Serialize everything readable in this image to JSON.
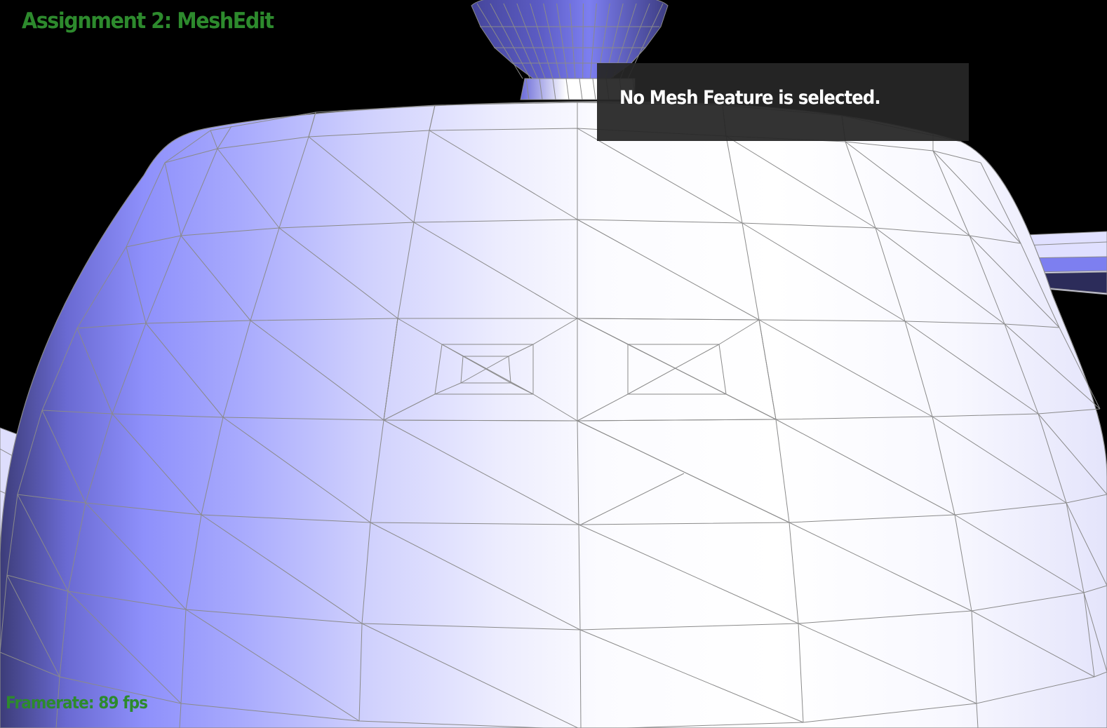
{
  "app": {
    "title": "Assignment 2: MeshEdit"
  },
  "info_panel": {
    "message": "No Mesh Feature is selected."
  },
  "status": {
    "framerate": "Framerate: 89 fps"
  },
  "scene": {
    "object": "teapot-mesh",
    "background_color": "#000000",
    "mesh_base_color": "#8a8cff",
    "mesh_highlight_color": "#ffffff",
    "edge_color": "#8a8a8a"
  },
  "colors": {
    "title": "#2d8a2d",
    "panel_bg": "#262626",
    "panel_text": "#ffffff"
  }
}
